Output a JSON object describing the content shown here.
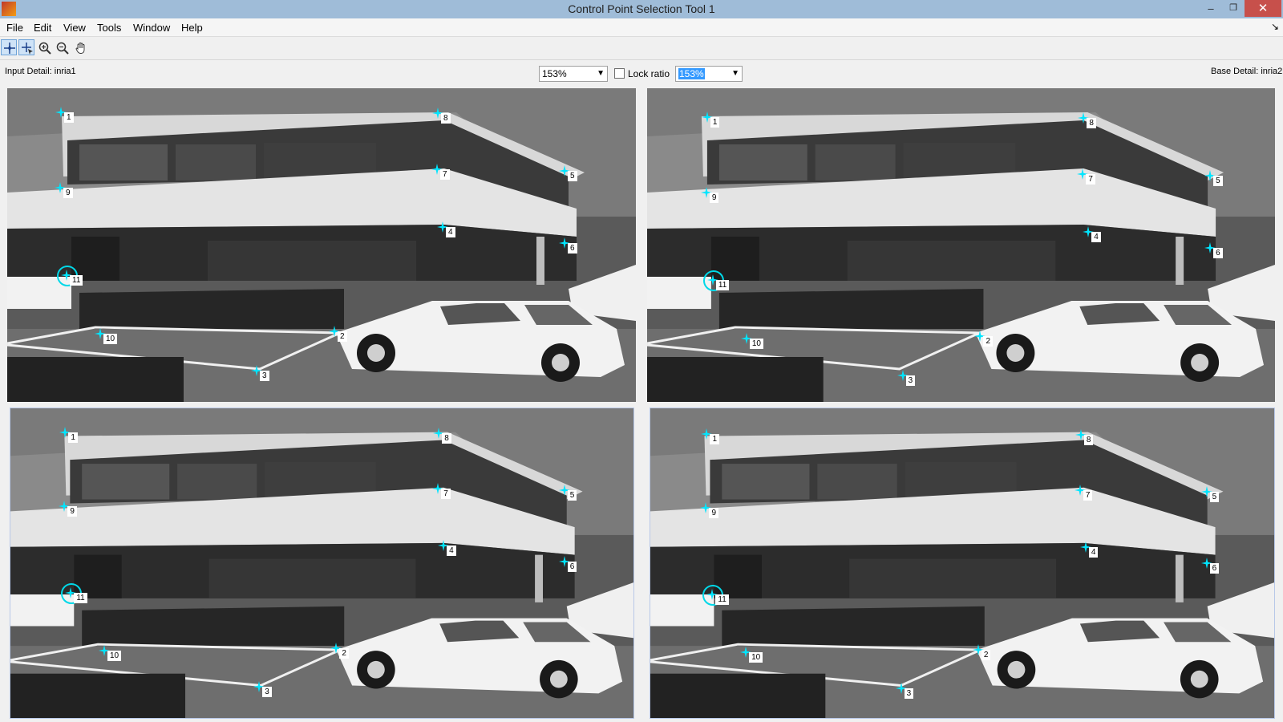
{
  "window": {
    "title": "Control Point Selection Tool 1",
    "min": "–",
    "max": "❐",
    "close": "✕"
  },
  "menu": [
    "File",
    "Edit",
    "View",
    "Tools",
    "Window",
    "Help"
  ],
  "toolbar": {
    "tools": [
      "add-point-icon",
      "select-point-icon",
      "zoom-in-icon",
      "zoom-out-icon",
      "pan-hand-icon"
    ]
  },
  "info": {
    "input_detail": "Input Detail: inria1",
    "base_detail": "Base Detail: inria2",
    "input_zoom": "153%",
    "base_zoom": "153%",
    "lock_ratio": "Lock ratio",
    "lock_checked": false
  },
  "points": [
    "1",
    "2",
    "3",
    "4",
    "5",
    "6",
    "7",
    "8",
    "9",
    "10",
    "11"
  ],
  "colors": {
    "marker": "#00e5ff",
    "title_bar": "#9fbcd8",
    "close": "#c7504b"
  }
}
